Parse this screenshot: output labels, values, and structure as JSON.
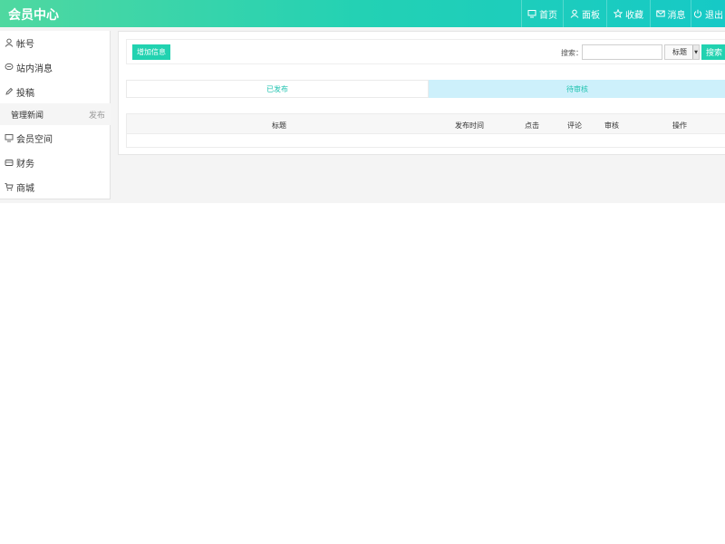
{
  "header": {
    "title": "会员中心",
    "nav": [
      {
        "label": "首页",
        "icon": "monitor-icon"
      },
      {
        "label": "面板",
        "icon": "user-icon"
      },
      {
        "label": "收藏",
        "icon": "star-icon"
      },
      {
        "label": "消息",
        "icon": "mail-icon"
      },
      {
        "label": "退出",
        "icon": "power-icon"
      }
    ]
  },
  "sidebar": {
    "items": [
      {
        "label": "帐号",
        "icon": "user-icon"
      },
      {
        "label": "站内消息",
        "icon": "chat-icon"
      },
      {
        "label": "投稿",
        "icon": "pen-icon"
      },
      {
        "label": "会员空间",
        "icon": "monitor-icon"
      },
      {
        "label": "财务",
        "icon": "wallet-icon"
      },
      {
        "label": "商城",
        "icon": "cart-icon"
      }
    ],
    "sub": {
      "label": "管理新闻",
      "action": "发布"
    }
  },
  "toolbar": {
    "add_label": "增加信息",
    "search_label": "搜索：",
    "search_value": "",
    "select_value": "标题",
    "search_button": "搜索"
  },
  "tabs": [
    {
      "label": "已发布",
      "active": false
    },
    {
      "label": "待审核",
      "active": true
    }
  ],
  "table": {
    "columns": [
      "标题",
      "发布时间",
      "点击",
      "评论",
      "审核",
      "操作"
    ],
    "rows": []
  },
  "colors": {
    "accent": "#21d2b0",
    "header_start": "#4fd8a0",
    "header_end": "#16c9c6",
    "tab_active_bg": "#cdf0fb"
  }
}
